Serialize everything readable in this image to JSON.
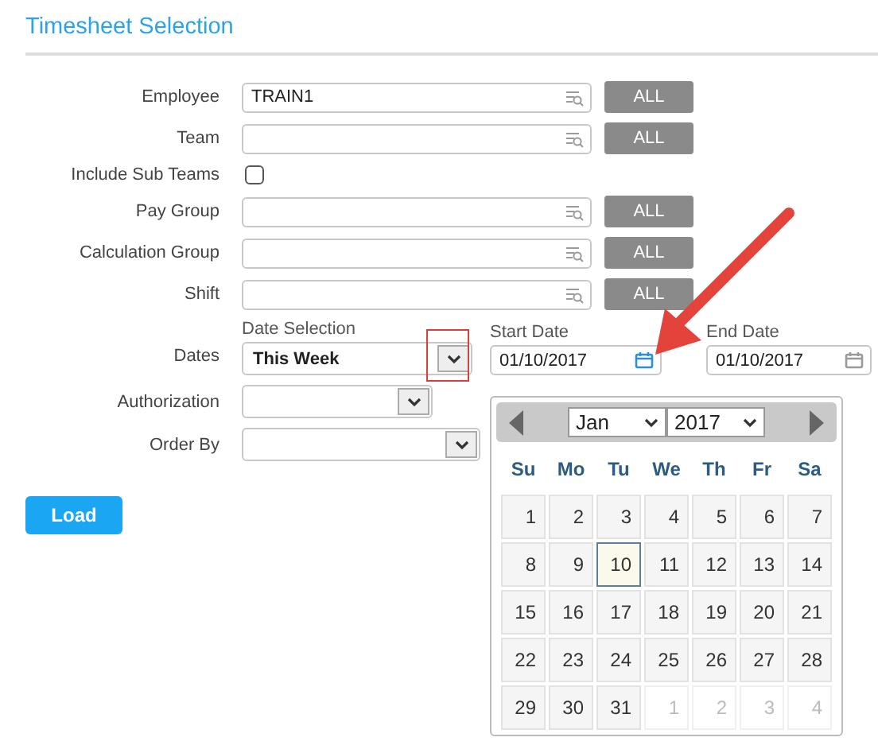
{
  "title": "Timesheet Selection",
  "fields": [
    {
      "kind": "lookup",
      "label": "Employee",
      "value": "TRAIN1",
      "button": "ALL"
    },
    {
      "kind": "lookup",
      "label": "Team",
      "button": "ALL"
    },
    {
      "kind": "checkbox",
      "label": "Include Sub Teams",
      "checked": false
    },
    {
      "kind": "lookup",
      "label": "Pay Group",
      "button": "ALL"
    },
    {
      "kind": "lookup",
      "label": "Calculation Group",
      "button": "ALL"
    },
    {
      "kind": "lookup",
      "label": "Shift",
      "button": "ALL"
    },
    {
      "kind": "dates",
      "label": "Dates",
      "selection_label": "Date Selection",
      "selection": "This Week",
      "highlighted": true,
      "start": {
        "label": "Start Date",
        "value": "01/10/2017",
        "active": true
      },
      "end": {
        "label": "End Date",
        "value": "01/10/2017",
        "active": false
      }
    },
    {
      "kind": "select",
      "label": "Authorization"
    },
    {
      "kind": "wideselect",
      "label": "Order By"
    }
  ],
  "load_button": "Load",
  "calendar": {
    "month": "Jan",
    "year": "2017",
    "weekdays": [
      "Su",
      "Mo",
      "Tu",
      "We",
      "Th",
      "Fr",
      "Sa"
    ],
    "weeks": [
      [
        {
          "day": "1",
          "other_month": false,
          "selected": false
        },
        {
          "day": "2",
          "other_month": false,
          "selected": false
        },
        {
          "day": "3",
          "other_month": false,
          "selected": false
        },
        {
          "day": "4",
          "other_month": false,
          "selected": false
        },
        {
          "day": "5",
          "other_month": false,
          "selected": false
        },
        {
          "day": "6",
          "other_month": false,
          "selected": false
        },
        {
          "day": "7",
          "other_month": false,
          "selected": false
        }
      ],
      [
        {
          "day": "8",
          "other_month": false,
          "selected": false
        },
        {
          "day": "9",
          "other_month": false,
          "selected": false
        },
        {
          "day": "10",
          "other_month": false,
          "selected": true
        },
        {
          "day": "11",
          "other_month": false,
          "selected": false
        },
        {
          "day": "12",
          "other_month": false,
          "selected": false
        },
        {
          "day": "13",
          "other_month": false,
          "selected": false
        },
        {
          "day": "14",
          "other_month": false,
          "selected": false
        }
      ],
      [
        {
          "day": "15",
          "other_month": false,
          "selected": false
        },
        {
          "day": "16",
          "other_month": false,
          "selected": false
        },
        {
          "day": "17",
          "other_month": false,
          "selected": false
        },
        {
          "day": "18",
          "other_month": false,
          "selected": false
        },
        {
          "day": "19",
          "other_month": false,
          "selected": false
        },
        {
          "day": "20",
          "other_month": false,
          "selected": false
        },
        {
          "day": "21",
          "other_month": false,
          "selected": false
        }
      ],
      [
        {
          "day": "22",
          "other_month": false,
          "selected": false
        },
        {
          "day": "23",
          "other_month": false,
          "selected": false
        },
        {
          "day": "24",
          "other_month": false,
          "selected": false
        },
        {
          "day": "25",
          "other_month": false,
          "selected": false
        },
        {
          "day": "26",
          "other_month": false,
          "selected": false
        },
        {
          "day": "27",
          "other_month": false,
          "selected": false
        },
        {
          "day": "28",
          "other_month": false,
          "selected": false
        }
      ],
      [
        {
          "day": "29",
          "other_month": false,
          "selected": false
        },
        {
          "day": "30",
          "other_month": false,
          "selected": false
        },
        {
          "day": "31",
          "other_month": false,
          "selected": false
        },
        {
          "day": "1",
          "other_month": true,
          "selected": false
        },
        {
          "day": "2",
          "other_month": true,
          "selected": false
        },
        {
          "day": "3",
          "other_month": true,
          "selected": false
        },
        {
          "day": "4",
          "other_month": true,
          "selected": false
        }
      ]
    ]
  }
}
